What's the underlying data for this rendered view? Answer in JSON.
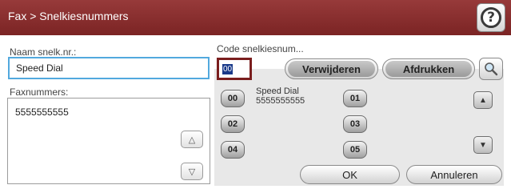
{
  "header": {
    "title": "Fax > Snelkiesnummers",
    "help_icon": "question-mark-icon",
    "help_glyph": "?"
  },
  "left": {
    "name_label": "Naam snelk.nr.:",
    "name_value": "Speed Dial",
    "fax_label": "Faxnummers:",
    "fax_value": "5555555555"
  },
  "right": {
    "code_label": "Code snelkiesnum...",
    "code_value": "00",
    "delete_label": "Verwijderen",
    "print_label": "Afdrukken",
    "search_icon": "magnifier-icon"
  },
  "speed_dials": [
    {
      "code": "00",
      "name": "Speed Dial",
      "number": "5555555555"
    },
    {
      "code": "01",
      "name": "",
      "number": ""
    },
    {
      "code": "02",
      "name": "",
      "number": ""
    },
    {
      "code": "03",
      "name": "",
      "number": ""
    },
    {
      "code": "04",
      "name": "",
      "number": ""
    },
    {
      "code": "05",
      "name": "",
      "number": ""
    }
  ],
  "footer": {
    "ok_label": "OK",
    "cancel_label": "Annuleren"
  },
  "colors": {
    "titlebar": "#8a2e2e",
    "selected_field_border": "#52a9de",
    "code_box_border": "#7a1e1e"
  }
}
